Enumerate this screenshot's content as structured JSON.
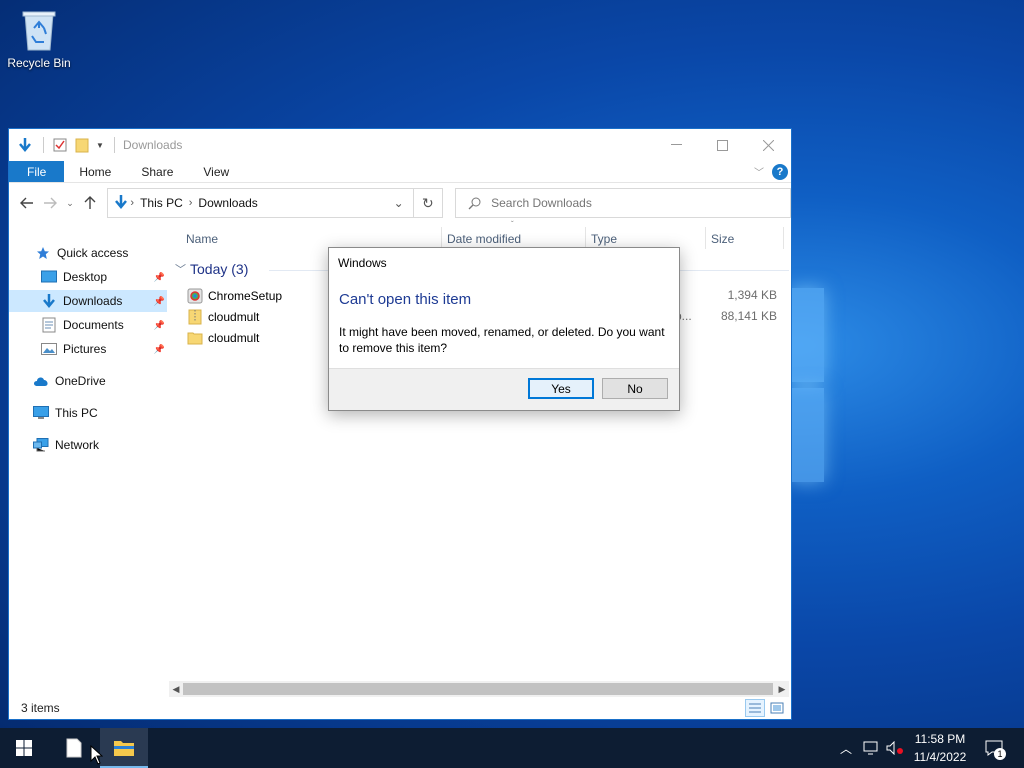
{
  "desktop": {
    "recycle_bin_label": "Recycle Bin"
  },
  "explorer": {
    "title": "Downloads",
    "ribbon_tabs": [
      "File",
      "Home",
      "Share",
      "View"
    ],
    "address": {
      "crumbs": [
        "This PC",
        "Downloads"
      ]
    },
    "search_placeholder": "Search Downloads",
    "nav_items": [
      {
        "label": "Quick access",
        "icon": "star-icon"
      },
      {
        "label": "Desktop",
        "icon": "desktop-folder-icon",
        "pinned": true
      },
      {
        "label": "Downloads",
        "icon": "downloads-folder-icon",
        "pinned": true,
        "selected": true
      },
      {
        "label": "Documents",
        "icon": "documents-folder-icon",
        "pinned": true
      },
      {
        "label": "Pictures",
        "icon": "pictures-folder-icon",
        "pinned": true
      },
      {
        "label": "OneDrive",
        "icon": "onedrive-cloud-icon"
      },
      {
        "label": "This PC",
        "icon": "computer-icon"
      },
      {
        "label": "Network",
        "icon": "network-icon"
      }
    ],
    "columns": {
      "name": "Name",
      "date_modified": "Date modified",
      "type": "Type",
      "size": "Size"
    },
    "group_label": "Today (3)",
    "files": [
      {
        "name": "ChromeSetup",
        "type": "",
        "size": "1,394 KB",
        "icon": "setup-app-icon"
      },
      {
        "name": "cloudmult",
        "type": "p...",
        "size": "88,141 KB",
        "icon": "zip-folder-icon"
      },
      {
        "name": "cloudmult",
        "type": "",
        "size": "",
        "icon": "folder-icon"
      }
    ],
    "status": "3 items"
  },
  "dialog": {
    "title": "Windows",
    "heading": "Can't open this item",
    "message": "It might have been moved, renamed, or deleted. Do you want to remove this item?",
    "yes_label": "Yes",
    "no_label": "No"
  },
  "taskbar": {
    "time": "11:58 PM",
    "date": "11/4/2022",
    "notification_count": "1"
  },
  "colors": {
    "accent": "#1979ca",
    "taskbar": "#0d1d33",
    "selection": "#cce8ff",
    "dialog_heading": "#1e3b94"
  }
}
